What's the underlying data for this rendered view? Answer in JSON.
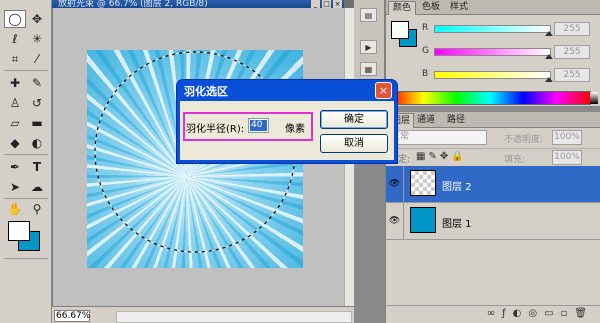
{
  "document": {
    "title": "放射光束 @ 66.7% (图层 2, RGB/8)",
    "zoom": "66.67%"
  },
  "toolbox": {
    "tools": [
      "marquee",
      "move",
      "lasso",
      "magic-wand",
      "crop",
      "eyedropper",
      "healing",
      "brush",
      "stamp",
      "history-brush",
      "eraser",
      "gradient",
      "blur",
      "dodge",
      "pen",
      "type",
      "path-select",
      "shape",
      "hand",
      "zoom"
    ]
  },
  "dialog": {
    "title": "羽化选区",
    "radius_label": "羽化半径(R):",
    "radius_value": "40",
    "unit_label": "像素",
    "ok_label": "确定",
    "cancel_label": "取消",
    "close_label": "×",
    "highlight_color": "#e030d0"
  },
  "color_panel": {
    "tabs": [
      "颜色",
      "色板",
      "样式"
    ],
    "channels": [
      {
        "label": "R",
        "value": "255"
      },
      {
        "label": "G",
        "value": "255"
      },
      {
        "label": "B",
        "value": "255"
      }
    ],
    "foreground": "#ffffff",
    "background": "#0096c8"
  },
  "layers_panel": {
    "tabs": [
      "图层",
      "通道",
      "路径"
    ],
    "blend_mode": "正常",
    "opacity_label": "不透明度:",
    "opacity_value": "100%",
    "lock_label": "锁定:",
    "fill_label": "填充:",
    "fill_value": "100%",
    "layers": [
      {
        "name": "图层 2",
        "selected": true,
        "thumb": "transparent"
      },
      {
        "name": "图层 1",
        "selected": false,
        "thumb": "#0096c8"
      }
    ]
  }
}
